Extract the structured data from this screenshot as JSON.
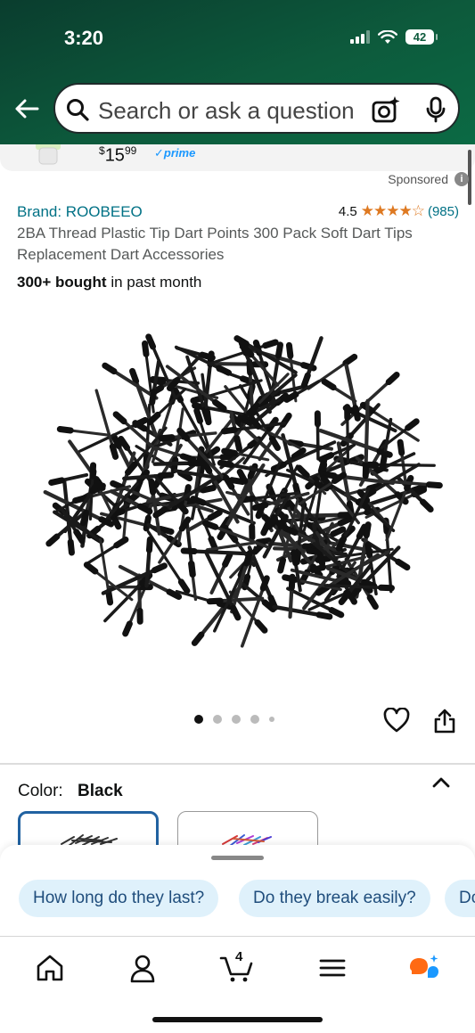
{
  "status_bar": {
    "time": "3:20",
    "battery": "42"
  },
  "search": {
    "placeholder": "Search or ask a question"
  },
  "peek": {
    "price_whole": "15",
    "price_fraction": "99",
    "price_symbol": "$",
    "prime": "✓prime"
  },
  "listing": {
    "sponsored": "Sponsored",
    "brand": "Brand: ROOBEEO",
    "rating": "4.5",
    "stars": "★★★★☆",
    "rating_count": "(985)",
    "title": "2BA Thread Plastic Tip Dart Points 300 Pack Soft Dart Tips Replacement Dart Accessories",
    "bought_bold": "300+ bought",
    "bought_rest": " in past month"
  },
  "gallery": {
    "image_count": 5,
    "active_index": 0
  },
  "variation": {
    "label": "Color:",
    "value": "Black"
  },
  "suggestions": [
    "How long do they last?",
    "Do they break easily?",
    "Do"
  ],
  "tabbar": {
    "cart_count": "4"
  },
  "colors": {
    "header_dark": "#0a3d2e",
    "link": "#007185",
    "star": "#de7921",
    "chip_bg": "#dff1fb",
    "selected_swatch": "#2162a1",
    "ai_orange": "#ff6a13",
    "ai_blue": "#1a98ff"
  }
}
